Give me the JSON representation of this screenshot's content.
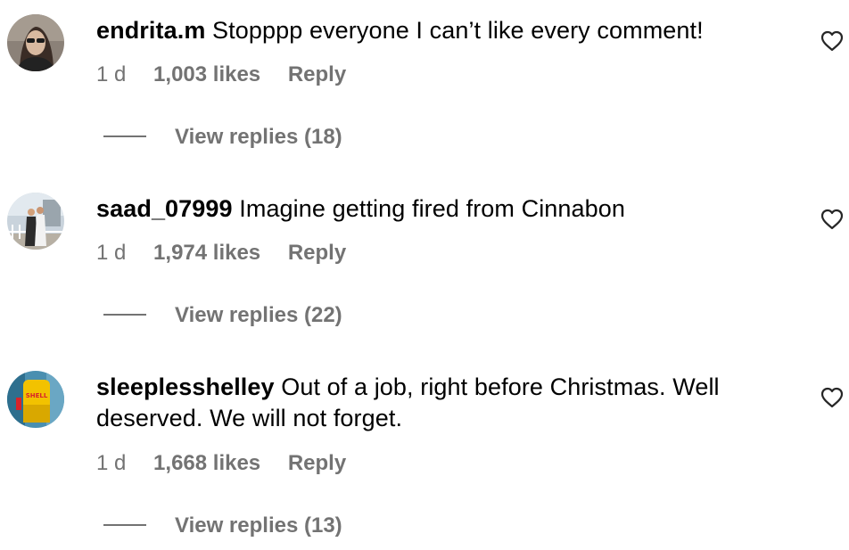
{
  "comments": [
    {
      "username": "endrita.m",
      "text": "Stopppp everyone I can’t like every comment!",
      "time": "1 d",
      "likes": "1,003 likes",
      "reply_label": "Reply",
      "view_replies": "View replies (18)",
      "avatar_icon": "avatar-woman-sunglasses"
    },
    {
      "username": "saad_07999",
      "text": "Imagine getting fired from Cinnabon",
      "time": "1 d",
      "likes": "1,974 likes",
      "reply_label": "Reply",
      "view_replies": "View replies (22)",
      "avatar_icon": "avatar-couple-photo"
    },
    {
      "username": "sleeplesshelley",
      "text": "Out of a job, right before Christmas. Well deserved. We will not forget.",
      "time": "1 d",
      "likes": "1,668 likes",
      "reply_label": "Reply",
      "view_replies": "View replies (13)",
      "avatar_icon": "avatar-shell-sign",
      "avatar_text": "SHELL"
    }
  ],
  "icons": {
    "like": "heart-icon"
  },
  "colors": {
    "text": "#000000",
    "secondary": "#737373",
    "background": "#ffffff"
  }
}
